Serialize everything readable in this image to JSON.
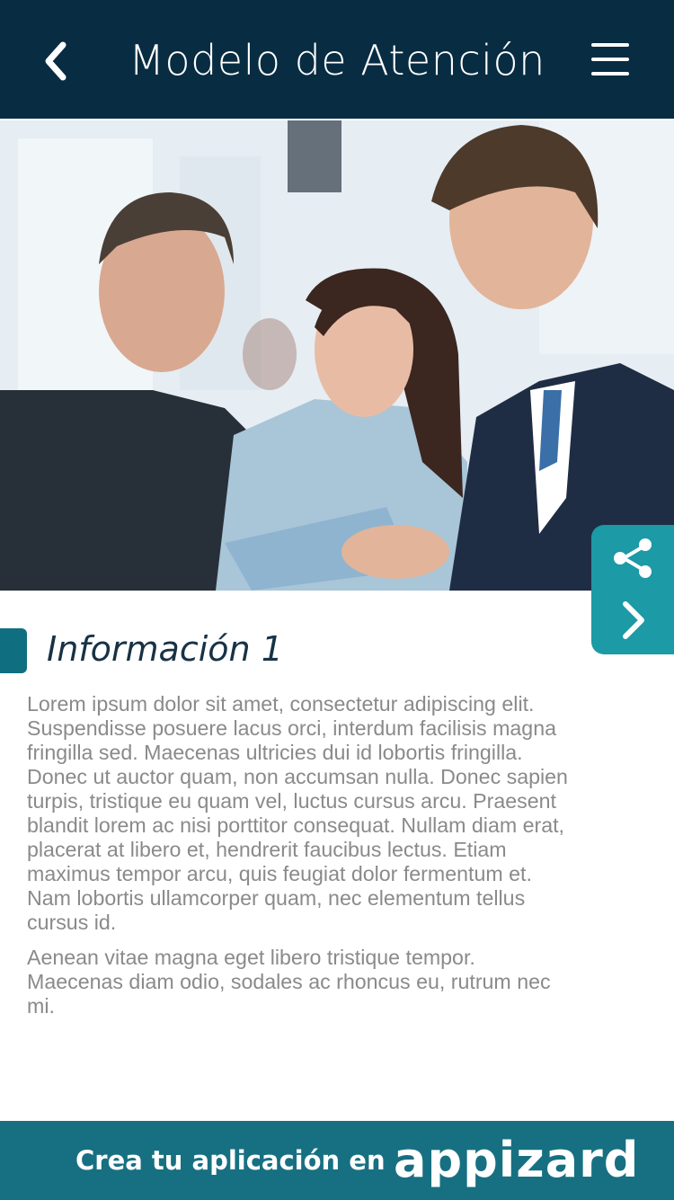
{
  "header": {
    "title": "Modelo de Atención",
    "back_icon": "chevron-left-icon",
    "menu_icon": "hamburger-menu-icon"
  },
  "hero": {
    "image": "photo of three people looking at a clipboard"
  },
  "side_actions": {
    "share_icon": "share-icon",
    "next_icon": "chevron-right-icon",
    "color": "#1c9aa6"
  },
  "content": {
    "section_title": "Información 1",
    "paragraphs": [
      "Lorem ipsum dolor sit amet, consectetur adipiscing elit. Suspendisse posuere lacus orci, interdum facilisis magna fringilla sed. Maecenas ultricies dui id lobortis fringilla. Donec ut auctor quam, non accumsan nulla. Donec sapien turpis, tristique eu quam vel, luctus cursus arcu. Praesent blandit lorem ac nisi porttitor consequat. Nullam diam erat, placerat at libero et, hendrerit faucibus lectus. Etiam maximus tempor arcu, quis feugiat dolor fermentum et. Nam lobortis ullamcorper quam, nec elementum tellus cursus id.",
      "Aenean vitae magna eget libero tristique tempor. Maecenas diam odio, sodales ac rhoncus eu, rutrum nec mi."
    ]
  },
  "footer": {
    "text": "Crea tu aplicación en",
    "brand": "appizard"
  },
  "colors": {
    "header_bg": "#082c42",
    "accent": "#1c9aa6",
    "footer_bg": "#177082",
    "body_text": "#8a8a8a"
  }
}
